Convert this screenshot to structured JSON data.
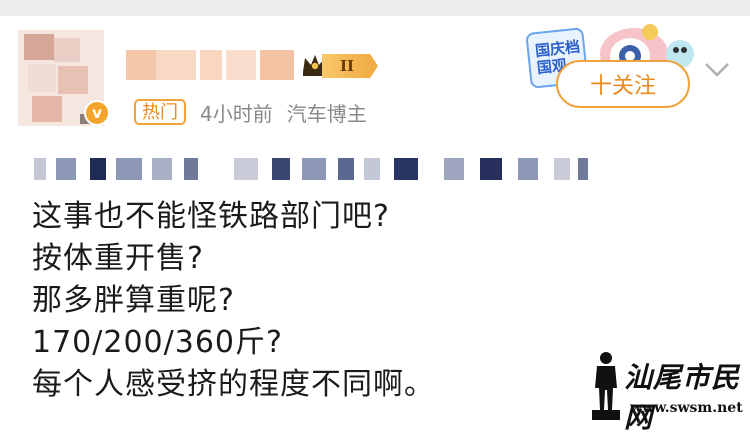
{
  "post": {
    "hot_tag": "热门",
    "time": "4小时前",
    "role": "汽车博主",
    "level_badge": "II",
    "follow_label": "十关注",
    "sticker_text": [
      "国庆档",
      "国观"
    ],
    "body_lines": [
      "这事也不能怪铁路部门吧?",
      "按体重开售?",
      "那多胖算重呢?",
      "170/200/360斤?",
      "每个人感受挤的程度不同啊。"
    ]
  },
  "watermark": {
    "title": "汕尾市民网",
    "url": "www.swsm.net"
  },
  "icons": {
    "verified": "verified-v-icon",
    "crown": "crown-icon",
    "chevron": "chevron-down-icon",
    "silhouette": "person-silhouette-icon"
  },
  "colors": {
    "accent_orange": "#e88b1c",
    "badge_gold": "#f0a93f",
    "meta_gray": "#8a8a8a",
    "text": "#1b1b1b"
  }
}
